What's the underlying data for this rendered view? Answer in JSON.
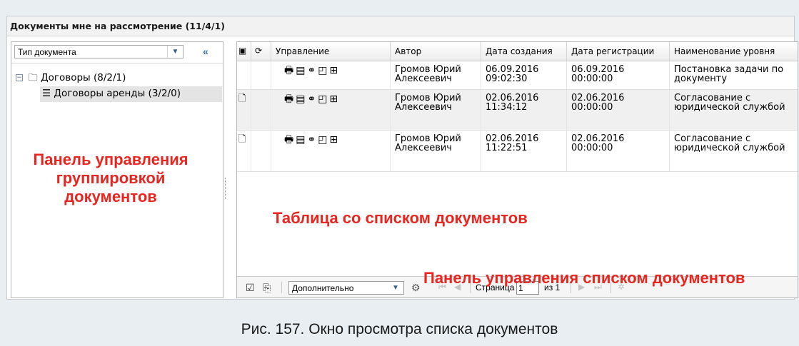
{
  "window": {
    "title": "Документы мне на рассмотрение (11/4/1)"
  },
  "left_panel": {
    "select_value": "Тип документа",
    "collapse_icon": "«",
    "tree": [
      {
        "label": "Договоры (8/2/1)"
      },
      {
        "label": "Договоры аренды (3/2/0)"
      }
    ],
    "annotation": "Панель управления группировкой документов"
  },
  "table": {
    "headers": [
      "Управление",
      "Автор",
      "Дата создания",
      "Дата регистрации",
      "Наименование уровня"
    ],
    "rows": [
      {
        "author": "Громов Юрий Алексеевич",
        "created": "06.09.2016 09:02:30",
        "registered": "06.09.2016 00:00:00",
        "level": "Постановка задачи по документу"
      },
      {
        "author": "Громов Юрий Алексеевич",
        "created": "02.06.2016 11:34:12",
        "registered": "02.06.2016 00:00:00",
        "level": "Согласование с юридической службой"
      },
      {
        "author": "Громов Юрий Алексеевич",
        "created": "02.06.2016 11:22:51",
        "registered": "02.06.2016 00:00:00",
        "level": "Согласование с юридической службой"
      }
    ],
    "annotation": "Таблица со списком документов"
  },
  "list_bar": {
    "annotation": "Панель управления списком документов",
    "select_value": "Дополнительно",
    "page_label": "Страница",
    "page_value": "1",
    "of_label": "из 1"
  },
  "caption": "Рис. 157. Окно просмотра списка документов",
  "colors": {
    "annotation": "#e8251f"
  }
}
